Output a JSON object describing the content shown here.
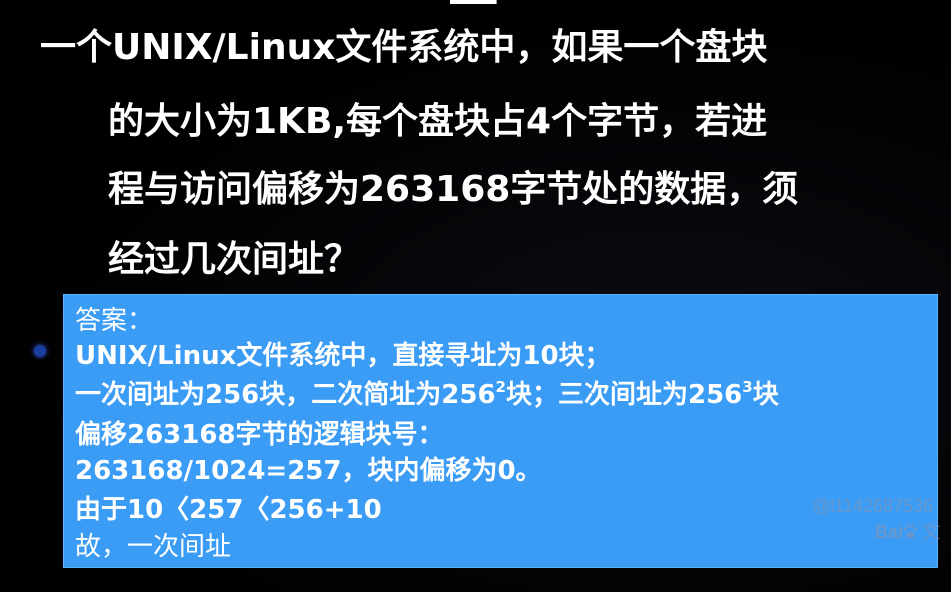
{
  "question": {
    "line1": "一个UNIX/Linux文件系统中，如果一个盘块",
    "line2": "的大小为1KB,每个盘块占4个字节，若进",
    "line3": "程与访问偏移为263168字节处的数据，须",
    "line4": "经过几次间址？"
  },
  "answer": {
    "line1": "答案：",
    "line2": "UNIX/Linux文件系统中，直接寻址为10块；",
    "line3": {
      "part1": "一次间址为256块，二次简址为256",
      "sup1": "2",
      "part2": "块；三次间址为256",
      "sup2": "3",
      "part3": "块"
    },
    "line4": "偏移263168字节的逻辑块号：",
    "line5": "263168/1024=257，块内偏移为0。",
    "line6": "由于10〈257〈256+10",
    "line7": "故，一次间址"
  },
  "watermark": {
    "text": "@l1142687536",
    "logo_text": "Bai",
    "logo_suffix": "文"
  },
  "colors": {
    "background": "#000000",
    "answer_box": "#3b9cf5",
    "text": "#ffffff"
  }
}
